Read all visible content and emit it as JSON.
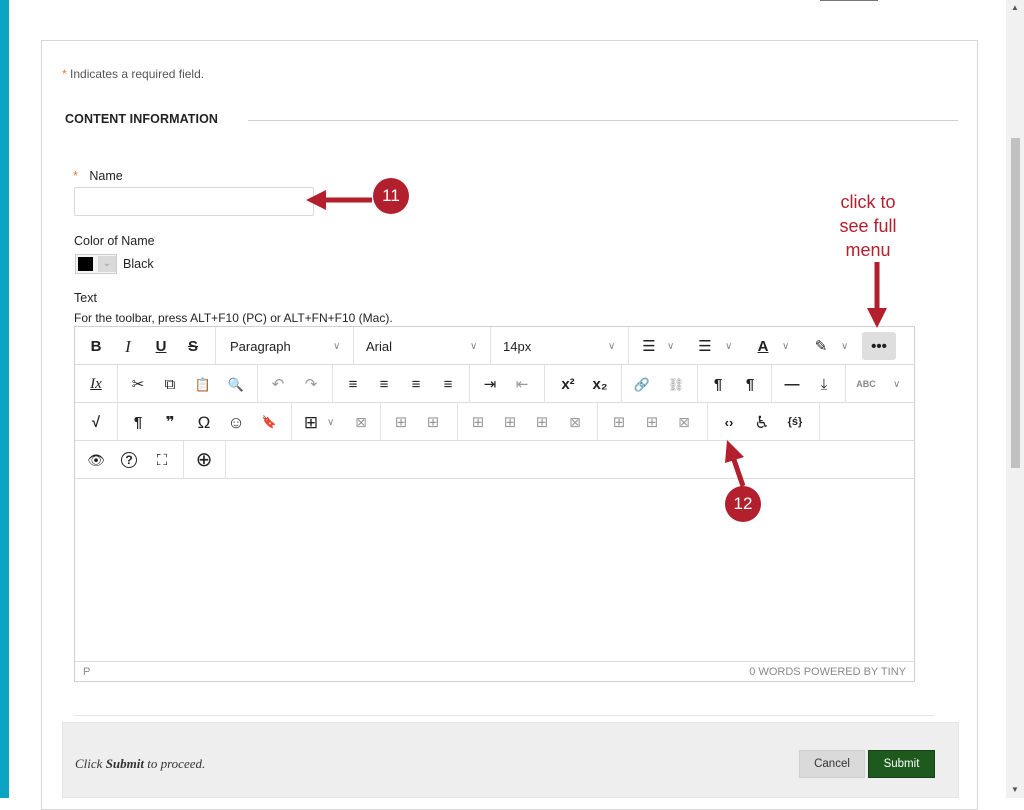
{
  "form": {
    "required_note": "Indicates a required field.",
    "required_mark": "*",
    "section_title": "CONTENT INFORMATION",
    "name_label": "Name",
    "name_value": "",
    "color_label": "Color of Name",
    "color_value": "Black",
    "color_hex": "#000000",
    "text_label": "Text",
    "toolbar_hint": "For the toolbar, press ALT+F10 (PC) or ALT+FN+F10 (Mac)."
  },
  "editor": {
    "block_format": "Paragraph",
    "font_family": "Arial",
    "font_size": "14px",
    "status_path": "P",
    "word_count": "0 WORDS",
    "powered_by": "POWERED BY TINY",
    "row1": {
      "bold": "B",
      "italic": "I",
      "underline": "U",
      "strike": "S",
      "bullet_list": "☰",
      "num_list": "☰",
      "text_color": "A",
      "highlight": "✎",
      "more": "•••"
    },
    "row2": {
      "clear_format": "Ix",
      "cut": "✂",
      "copy": "⧉",
      "paste": "📋",
      "find": "🔍",
      "undo": "↶",
      "redo": "↷",
      "align_left": "≡",
      "align_center": "≡",
      "align_right": "≡",
      "justify": "≡",
      "indent": "⇥",
      "outdent": "⇤",
      "superscript": "x²",
      "subscript": "x₂",
      "link": "🔗",
      "unlink": "⛓",
      "ltr": "¶",
      "rtl": "¶",
      "hr": "—",
      "anchor_down": "⤓",
      "spellcheck": "ABC"
    },
    "row3": {
      "math": "√",
      "pilcrow": "¶",
      "quote": "❞",
      "omega": "Ω",
      "emoji": "☺",
      "bookmark": "🔖",
      "table": "⊞",
      "source_code": "‹›",
      "accessibility": "♿",
      "variable": "{ś}"
    },
    "row4": {
      "preview": "👁",
      "help": "?",
      "fullscreen": "⛶",
      "add": "⊕"
    }
  },
  "annotations": {
    "callout_11": "11",
    "callout_12": "12",
    "hint_line1": "click to",
    "hint_line2": "see full",
    "hint_line3": "menu",
    "color": "#b21f2d"
  },
  "footer": {
    "submit_msg_prefix": "Click",
    "submit_msg_bold": "Submit",
    "submit_msg_suffix": "to proceed.",
    "cancel_label": "Cancel",
    "submit_label": "Submit"
  }
}
